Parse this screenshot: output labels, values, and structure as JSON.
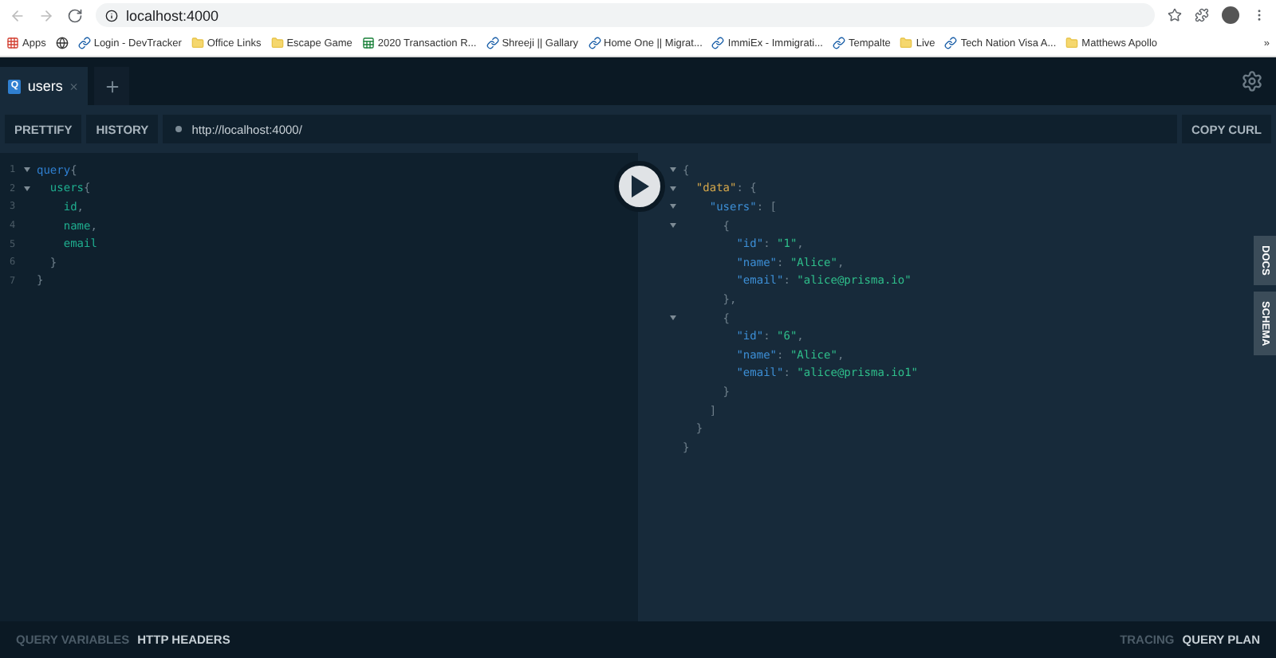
{
  "browser": {
    "address": "localhost:4000",
    "bookmarks": [
      {
        "label": "Apps",
        "kind": "apps"
      },
      {
        "kind": "globe"
      },
      {
        "label": "Login - DevTracker",
        "kind": "site"
      },
      {
        "label": "Office Links",
        "kind": "folder"
      },
      {
        "label": "Escape Game",
        "kind": "folder"
      },
      {
        "label": "2020 Transaction R...",
        "kind": "sheet"
      },
      {
        "label": "Shreeji || Gallary",
        "kind": "site"
      },
      {
        "label": "Home One || Migrat...",
        "kind": "site"
      },
      {
        "label": "ImmiEx - Immigrati...",
        "kind": "site"
      },
      {
        "label": "Tempalte",
        "kind": "site"
      },
      {
        "label": "Live",
        "kind": "folder"
      },
      {
        "label": "Tech Nation Visa A...",
        "kind": "site"
      },
      {
        "label": "Matthews Apollo",
        "kind": "folder"
      }
    ],
    "more": "»"
  },
  "tabs": [
    {
      "badge": "Q",
      "label": "users",
      "selected": true
    }
  ],
  "toolbar": {
    "buttons": [
      "PRETTIFY",
      "HISTORY"
    ],
    "url": "http://localhost:4000/",
    "copy": "COPY CURL"
  },
  "query": [
    {
      "number": "1",
      "fold": true,
      "tokens": [
        {
          "text": "query",
          "kind": "keyword"
        },
        {
          "text": "{",
          "kind": "punct"
        }
      ]
    },
    {
      "number": "2",
      "fold": true,
      "tokens": [
        {
          "text": "  users",
          "kind": "field"
        },
        {
          "text": "{",
          "kind": "punct"
        }
      ]
    },
    {
      "number": "3",
      "fold": false,
      "tokens": [
        {
          "text": "    id",
          "kind": "field"
        },
        {
          "text": ",",
          "kind": "punct"
        }
      ]
    },
    {
      "number": "4",
      "fold": false,
      "tokens": [
        {
          "text": "    name",
          "kind": "field"
        },
        {
          "text": ",",
          "kind": "punct"
        }
      ]
    },
    {
      "number": "5",
      "fold": false,
      "tokens": [
        {
          "text": "    email",
          "kind": "field"
        }
      ]
    },
    {
      "number": "6",
      "fold": false,
      "tokens": [
        {
          "text": "  }",
          "kind": "punct"
        }
      ]
    },
    {
      "number": "7",
      "fold": false,
      "tokens": [
        {
          "text": "}",
          "kind": "punct"
        }
      ]
    }
  ],
  "result": [
    {
      "fold": true,
      "tokens": [
        {
          "text": "{",
          "kind": "punct"
        }
      ]
    },
    {
      "fold": true,
      "tokens": [
        {
          "text": "  \"data\"",
          "kind": "topkey"
        },
        {
          "text": ": {",
          "kind": "punct"
        }
      ]
    },
    {
      "fold": true,
      "tokens": [
        {
          "text": "    \"users\"",
          "kind": "key"
        },
        {
          "text": ": [",
          "kind": "punct"
        }
      ]
    },
    {
      "fold": true,
      "tokens": [
        {
          "text": "      {",
          "kind": "punct"
        }
      ]
    },
    {
      "fold": false,
      "tokens": [
        {
          "text": "        \"id\"",
          "kind": "key"
        },
        {
          "text": ": ",
          "kind": "punct"
        },
        {
          "text": "\"1\"",
          "kind": "string"
        },
        {
          "text": ",",
          "kind": "punct"
        }
      ]
    },
    {
      "fold": false,
      "tokens": [
        {
          "text": "        \"name\"",
          "kind": "key"
        },
        {
          "text": ": ",
          "kind": "punct"
        },
        {
          "text": "\"Alice\"",
          "kind": "string"
        },
        {
          "text": ",",
          "kind": "punct"
        }
      ]
    },
    {
      "fold": false,
      "tokens": [
        {
          "text": "        \"email\"",
          "kind": "key"
        },
        {
          "text": ": ",
          "kind": "punct"
        },
        {
          "text": "\"alice@prisma.io\"",
          "kind": "string"
        }
      ]
    },
    {
      "fold": false,
      "tokens": [
        {
          "text": "      },",
          "kind": "punct"
        }
      ]
    },
    {
      "fold": true,
      "tokens": [
        {
          "text": "      {",
          "kind": "punct"
        }
      ]
    },
    {
      "fold": false,
      "tokens": [
        {
          "text": "        \"id\"",
          "kind": "key"
        },
        {
          "text": ": ",
          "kind": "punct"
        },
        {
          "text": "\"6\"",
          "kind": "string"
        },
        {
          "text": ",",
          "kind": "punct"
        }
      ]
    },
    {
      "fold": false,
      "tokens": [
        {
          "text": "        \"name\"",
          "kind": "key"
        },
        {
          "text": ": ",
          "kind": "punct"
        },
        {
          "text": "\"Alice\"",
          "kind": "string"
        },
        {
          "text": ",",
          "kind": "punct"
        }
      ]
    },
    {
      "fold": false,
      "tokens": [
        {
          "text": "        \"email\"",
          "kind": "key"
        },
        {
          "text": ": ",
          "kind": "punct"
        },
        {
          "text": "\"alice@prisma.io1\"",
          "kind": "string"
        }
      ]
    },
    {
      "fold": false,
      "tokens": [
        {
          "text": "      }",
          "kind": "punct"
        }
      ]
    },
    {
      "fold": false,
      "tokens": [
        {
          "text": "    ]",
          "kind": "punct"
        }
      ]
    },
    {
      "fold": false,
      "tokens": [
        {
          "text": "  }",
          "kind": "punct"
        }
      ]
    },
    {
      "fold": false,
      "tokens": [
        {
          "text": "}",
          "kind": "punct"
        }
      ]
    }
  ],
  "side_tabs": [
    "DOCS",
    "SCHEMA"
  ],
  "bottom_left": [
    {
      "label": "QUERY VARIABLES",
      "selected": false
    },
    {
      "label": "HTTP HEADERS",
      "selected": true
    }
  ],
  "bottom_right": [
    {
      "label": "TRACING",
      "selected": false
    },
    {
      "label": "QUERY PLAN",
      "selected": true
    }
  ]
}
